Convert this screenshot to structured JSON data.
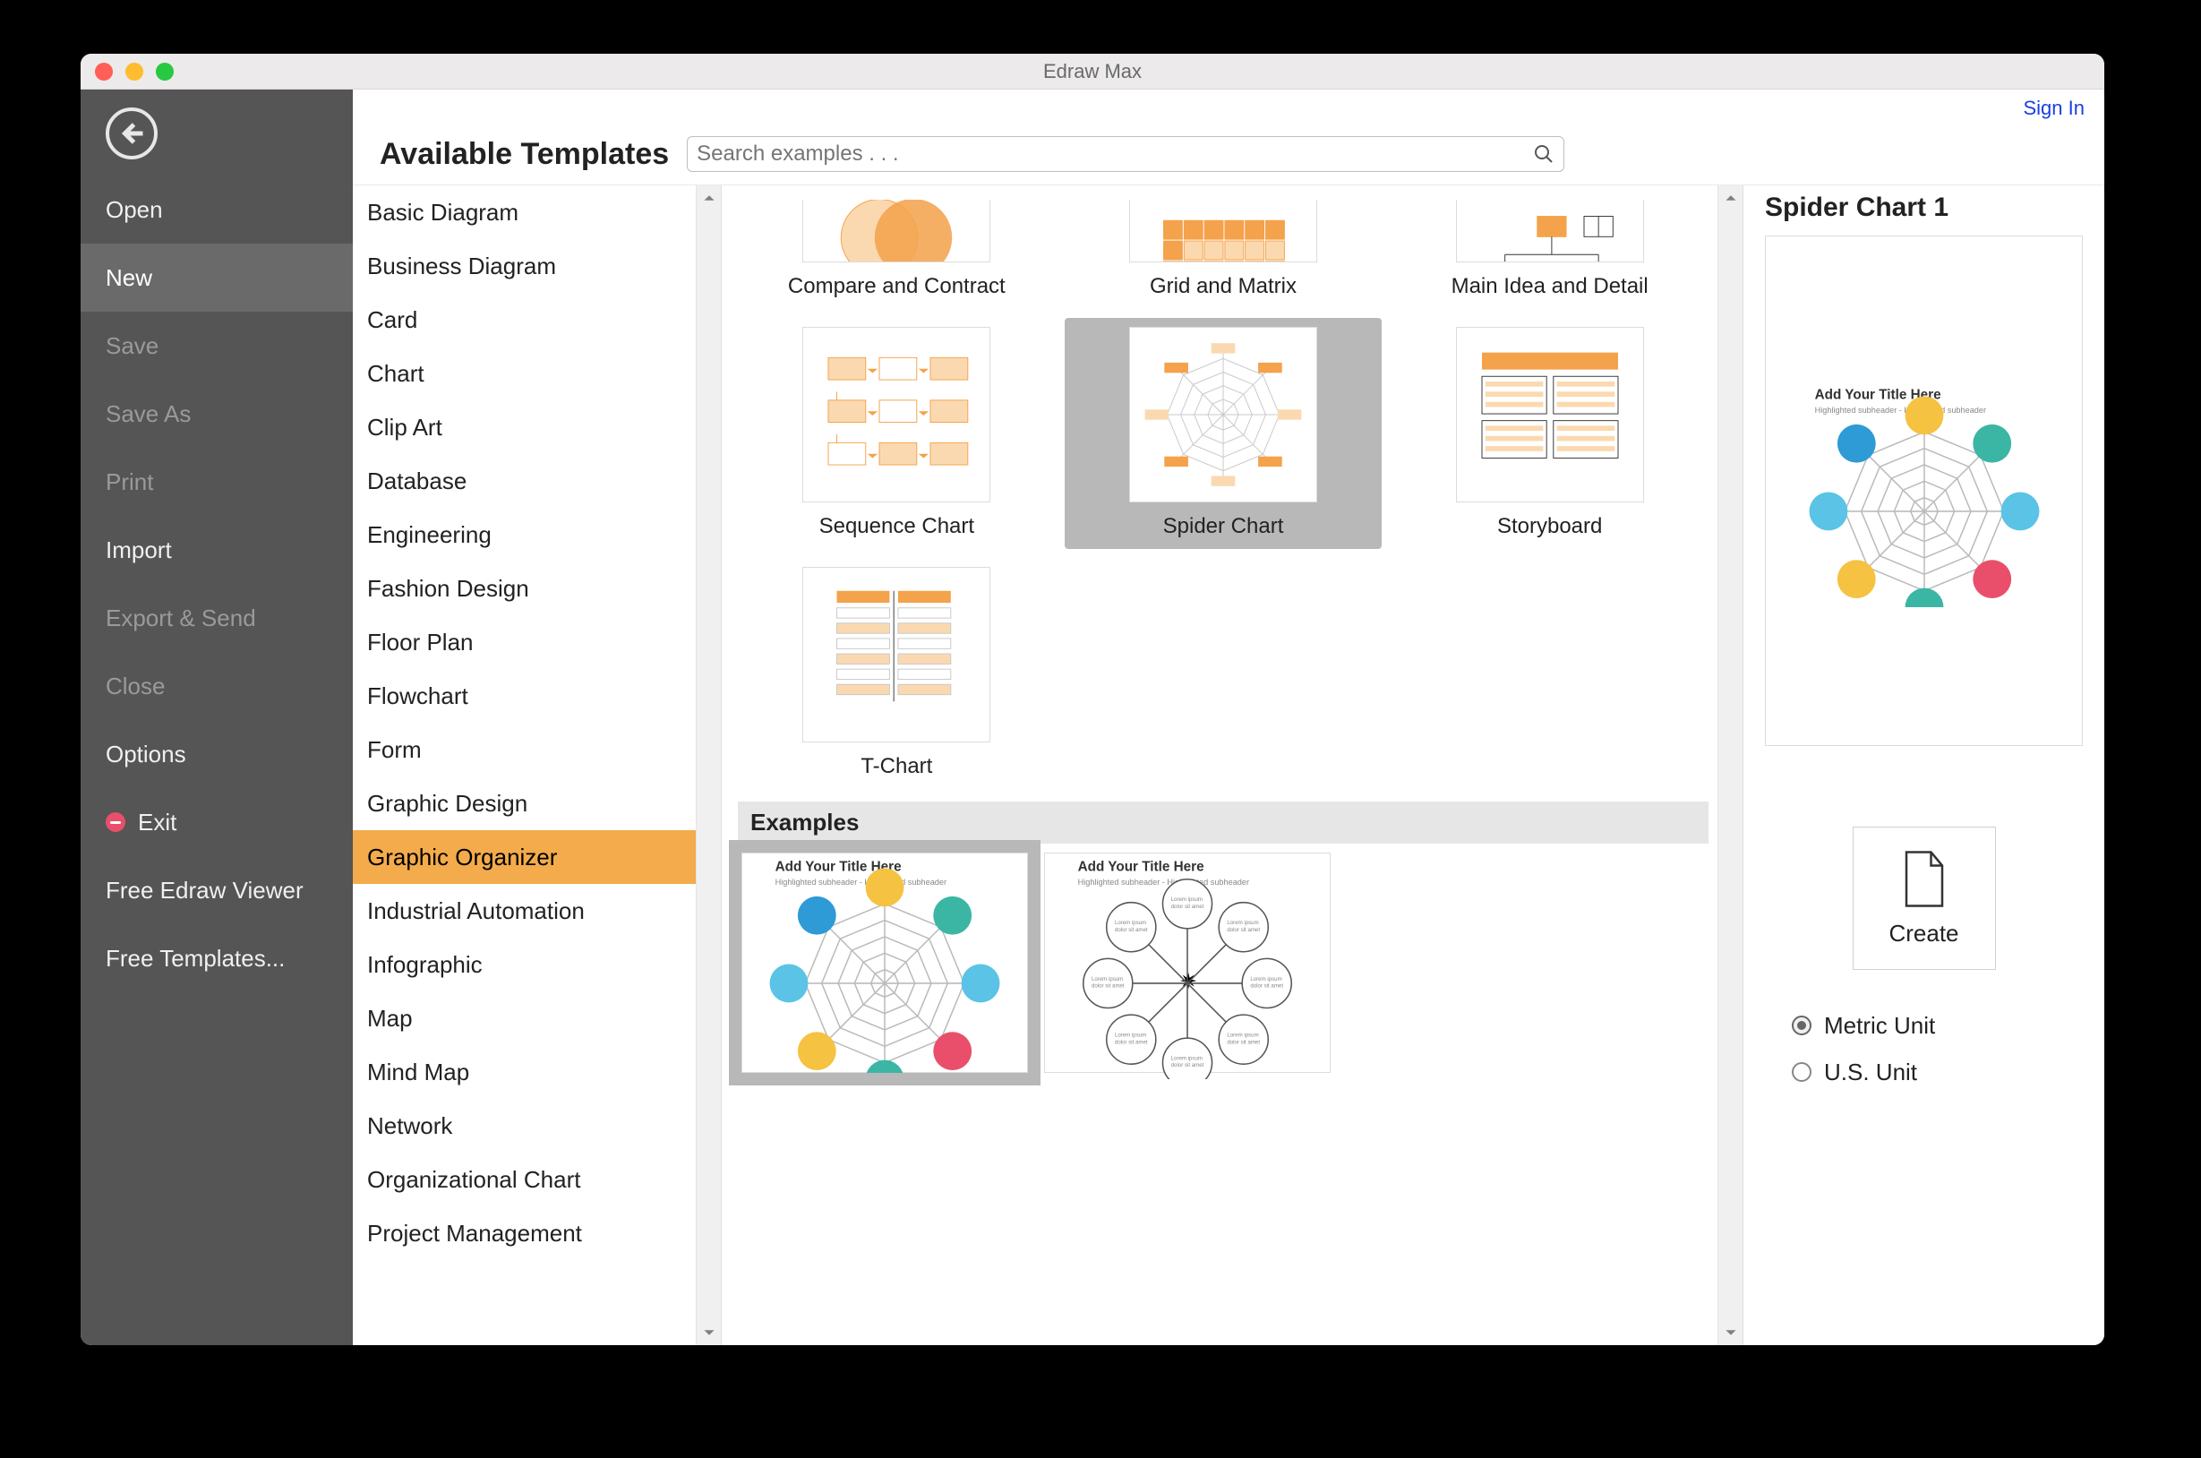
{
  "window": {
    "title": "Edraw Max",
    "sign_in": "Sign In"
  },
  "sidebar": {
    "items": [
      {
        "label": "Open",
        "tone": "light"
      },
      {
        "label": "New",
        "tone": "light",
        "selected": true
      },
      {
        "label": "Save",
        "tone": "dim"
      },
      {
        "label": "Save As",
        "tone": "dim"
      },
      {
        "label": "Print",
        "tone": "dim"
      },
      {
        "label": "Import",
        "tone": "light"
      },
      {
        "label": "Export & Send",
        "tone": "dim"
      },
      {
        "label": "Close",
        "tone": "dim"
      },
      {
        "label": "Options",
        "tone": "light"
      },
      {
        "label": "Exit",
        "tone": "light",
        "icon": "stop"
      },
      {
        "label": "Free Edraw Viewer",
        "tone": "light"
      },
      {
        "label": "Free Templates...",
        "tone": "light"
      }
    ]
  },
  "heading": "Available Templates",
  "search": {
    "placeholder": "Search examples . . ."
  },
  "categories": [
    "Basic Diagram",
    "Business Diagram",
    "Card",
    "Chart",
    "Clip Art",
    "Database",
    "Engineering",
    "Fashion Design",
    "Floor Plan",
    "Flowchart",
    "Form",
    "Graphic Design",
    "Graphic Organizer",
    "Industrial Automation",
    "Infographic",
    "Map",
    "Mind Map",
    "Network",
    "Organizational Chart",
    "Project Management"
  ],
  "selected_category_index": 12,
  "templates": [
    {
      "label": "Compare and Contract",
      "thumb": "compare",
      "partial": true
    },
    {
      "label": "Grid and Matrix",
      "thumb": "grid",
      "partial": true
    },
    {
      "label": "Main Idea and Detail",
      "thumb": "mainidea",
      "partial": true
    },
    {
      "label": "Sequence Chart",
      "thumb": "sequence"
    },
    {
      "label": "Spider Chart",
      "thumb": "spider",
      "selected": true
    },
    {
      "label": "Storyboard",
      "thumb": "storyboard"
    },
    {
      "label": "T-Chart",
      "thumb": "tchart"
    }
  ],
  "examples_label": "Examples",
  "examples": [
    {
      "thumb": "spider-color",
      "selected": true
    },
    {
      "thumb": "spider-plain"
    }
  ],
  "preview": {
    "title": "Spider Chart 1",
    "thumb": "spider-color",
    "thumb_title": "Add Your Title Here"
  },
  "create_label": "Create",
  "units": {
    "options": [
      "Metric Unit",
      "U.S. Unit"
    ],
    "selected": 0
  }
}
